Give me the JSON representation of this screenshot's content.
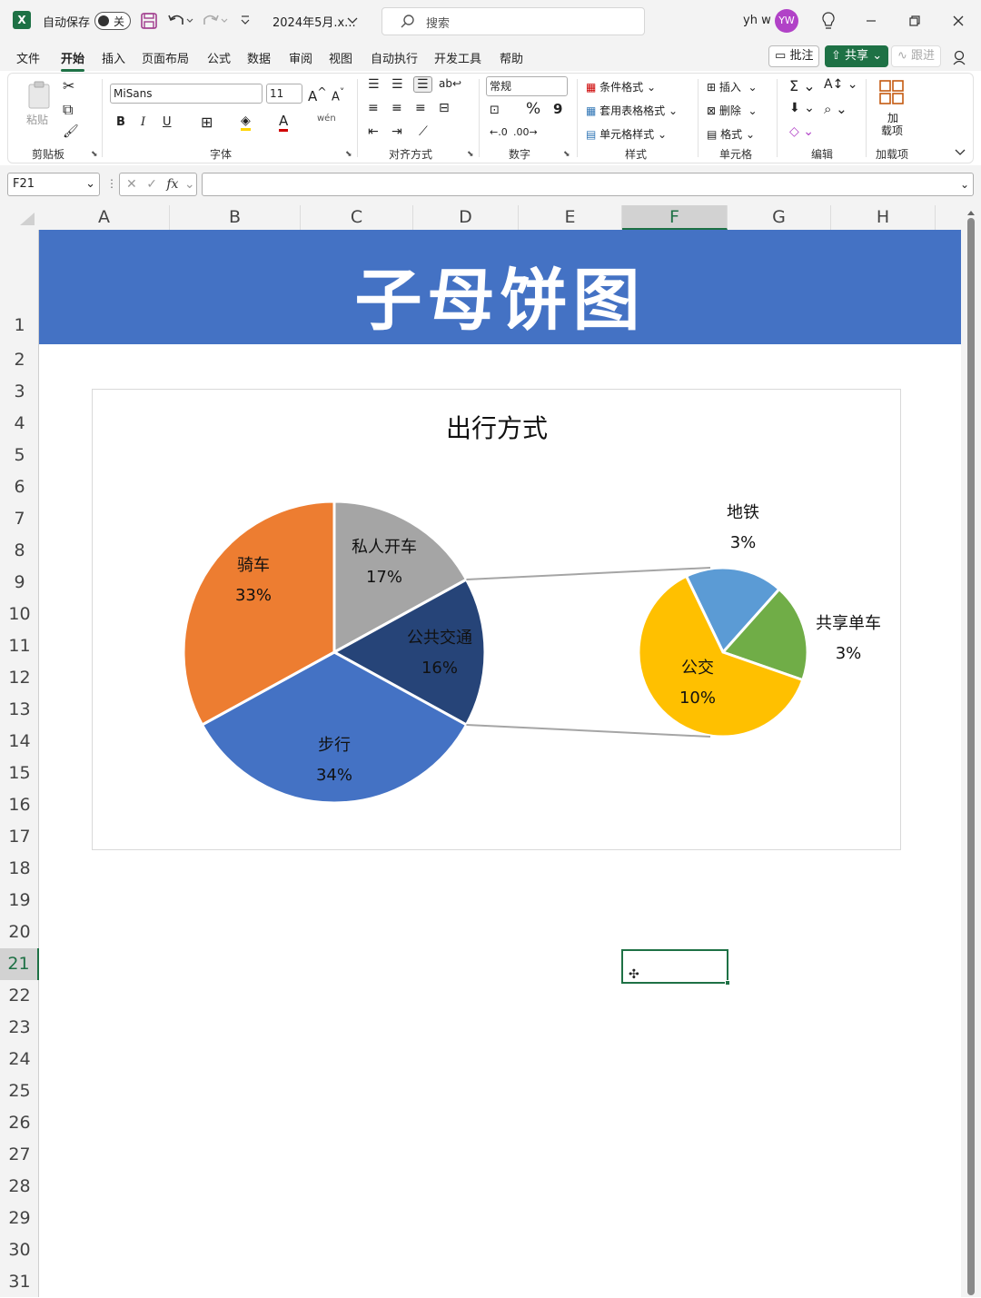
{
  "titlebar": {
    "autosave_label": "自动保存",
    "autosave_state": "关",
    "filename": "2024年5月.x...",
    "search_placeholder": "搜索",
    "user_name": "yh w",
    "avatar_initials": "YW"
  },
  "menu": {
    "tabs": [
      "文件",
      "开始",
      "插入",
      "页面布局",
      "公式",
      "数据",
      "审阅",
      "视图",
      "自动执行",
      "开发工具",
      "帮助"
    ],
    "active_tab": "开始",
    "comment_btn": "批注",
    "share_btn": "共享",
    "track_btn": "跟进"
  },
  "ribbon": {
    "clipboard": {
      "paste": "粘贴",
      "label": "剪贴板"
    },
    "font": {
      "name": "MiSans",
      "size": "11",
      "label": "字体",
      "bold": "B",
      "italic": "I",
      "underline": "U"
    },
    "alignment": {
      "label": "对齐方式"
    },
    "number": {
      "format": "常规",
      "label": "数字",
      "percent": "%",
      "comma": "9"
    },
    "styles": {
      "conditional": "条件格式",
      "table_format": "套用表格格式",
      "cell_style": "单元格样式",
      "label": "样式"
    },
    "cells": {
      "insert": "插入",
      "delete": "删除",
      "format": "格式",
      "label": "单元格"
    },
    "editing": {
      "label": "编辑"
    },
    "addins": {
      "btn_line1": "加",
      "btn_line2": "载项",
      "label": "加载项"
    }
  },
  "formula_bar": {
    "name_box": "F21",
    "fx": "fx",
    "value": ""
  },
  "sheet": {
    "columns": [
      "A",
      "B",
      "C",
      "D",
      "E",
      "F",
      "G",
      "H"
    ],
    "selected_column": "F",
    "rows": [
      "1",
      "2",
      "3",
      "4",
      "5",
      "6",
      "7",
      "8",
      "9",
      "10",
      "11",
      "12",
      "13",
      "14",
      "15",
      "16",
      "17",
      "18",
      "19",
      "20",
      "21",
      "22",
      "23",
      "24",
      "25",
      "26",
      "27",
      "28",
      "29",
      "30",
      "31"
    ],
    "selected_row": "21",
    "banner_title": "子母饼图",
    "banner_color": "#4472c4"
  },
  "chart_data": {
    "type": "pie",
    "subtype": "pie-of-pie",
    "title": "出行方式",
    "primary": {
      "categories": [
        "私人开车",
        "公共交通",
        "步行",
        "骑车"
      ],
      "values": [
        17,
        16,
        34,
        33
      ],
      "labels": [
        "17%",
        "16%",
        "34%",
        "33%"
      ],
      "colors": [
        "#a5a5a5",
        "#264478",
        "#4472c4",
        "#ed7d31"
      ]
    },
    "secondary": {
      "categories": [
        "地铁",
        "共享单车",
        "公交"
      ],
      "values": [
        3,
        3,
        10
      ],
      "labels": [
        "3%",
        "3%",
        "10%"
      ],
      "colors": [
        "#5b9bd5",
        "#70ad47",
        "#ffc000"
      ]
    },
    "legend": "none",
    "grid": false
  }
}
